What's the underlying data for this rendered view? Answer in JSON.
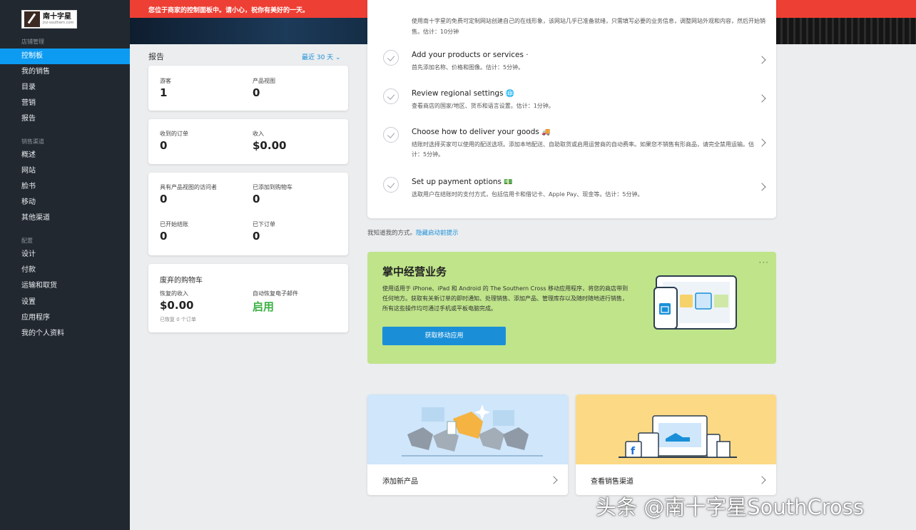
{
  "brand": {
    "logo_title": "南十字星",
    "logo_subtitle": "jnz-southern.com"
  },
  "alert": {
    "text": "您位于商家的控制面板中。请小心，祝你有美好的一天。"
  },
  "sidebar": {
    "sections": [
      {
        "label": "店铺管理",
        "items": [
          "控制板",
          "我的销售",
          "目录",
          "营销",
          "报告"
        ]
      },
      {
        "label": "销售渠道",
        "items": [
          "概述",
          "网站",
          "脸书",
          "移动",
          "其他渠道"
        ]
      },
      {
        "label": "配置",
        "items": [
          "设计",
          "付款",
          "运输和取货",
          "设置",
          "应用程序",
          "我的个人资料"
        ]
      }
    ],
    "active_item": "控制板"
  },
  "report": {
    "title": "报告",
    "range": "最近 30 天 ⌄",
    "card1": {
      "l1": "游客",
      "v1": "1",
      "l2": "产品视图",
      "v2": "0"
    },
    "card2": {
      "l1": "收到的订单",
      "v1": "0",
      "l2": "收入",
      "v2": "$0.00"
    },
    "card3": {
      "l1": "具有产品视图的访问者",
      "v1": "0",
      "l2": "已添加到购物车",
      "v2": "0",
      "l3": "已开始结账",
      "v3": "0",
      "l4": "已下订单",
      "v4": "0"
    },
    "card4": {
      "title": "废弃的购物车",
      "l1": "恢复的收入",
      "v1": "$0.00",
      "s1": "已恢复 0 个订单",
      "l2": "自动恢复电子邮件",
      "v2": "启用"
    }
  },
  "setup": {
    "first_desc": "使用南十字星的免费可定制网站创建自己的在线形象，该网站几乎已准备就绪，只需填写必要的业务信息，调整网站外观和内容，然后开始销售。估计：10分钟",
    "rows": [
      {
        "title": "Add your products or services",
        "emoji": "·",
        "desc": "首先添加名称、价格和图像。估计：5分钟。"
      },
      {
        "title": "Review regional settings",
        "emoji": "🌐",
        "desc": "查看商店的国家/地区、货币和语言设置。估计：1分钟。"
      },
      {
        "title": "Choose how to deliver your goods",
        "emoji": "🚚",
        "desc": "结账时选择买家可以使用的配送选项。添加本地配送、自助取货或启用运营商的自动费率。如果您不销售有形商品，请完全禁用运输。估计：5分钟。"
      },
      {
        "title": "Set up payment options",
        "emoji": "💵",
        "desc": "选取用户在结账时的支付方式，包括信用卡和借记卡、Apple Pay、现金等。估计：5分钟。"
      }
    ],
    "hint_text": "我知道我的方式。",
    "hint_link": "隐藏启动前提示"
  },
  "promo": {
    "title": "掌中经营业务",
    "desc": "使用适用于 iPhone、iPad 和 Android 的 The Southern Cross 移动应用程序，将您的商店带到任何地方。获取有关新订单的即时通知、处理销售、添加产品、管理库存以及随时随地进行销售，所有这些操作均可通过手机或平板电脑完成。",
    "button": "获取移动应用",
    "more": "···"
  },
  "tiles": [
    {
      "label": "添加新产品"
    },
    {
      "label": "查看销售渠道"
    }
  ],
  "watermark": "头条 @南十字星SouthCross",
  "colors": {
    "sidebar_bg": "#212830",
    "accent": "#0d9bf2",
    "alert": "#ee3f34",
    "promo_bg": "#bfe48a",
    "success": "#3cb043"
  }
}
